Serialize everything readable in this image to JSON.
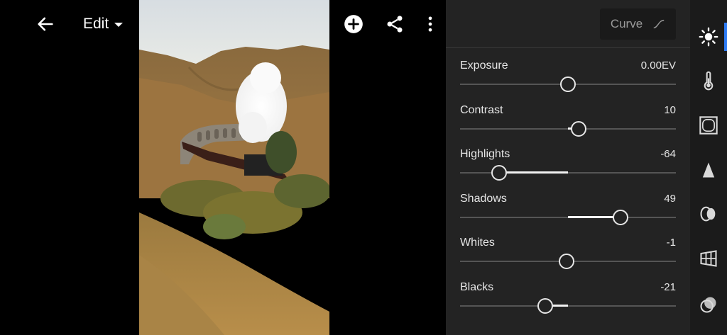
{
  "toolbar": {
    "back_icon": "arrow-left-icon",
    "edit_label": "Edit",
    "icons": [
      "undo-icon",
      "help-icon",
      "add-icon",
      "share-icon",
      "more-vertical-icon"
    ]
  },
  "panel": {
    "curve_label": "Curve",
    "sliders": [
      {
        "label": "Exposure",
        "value": "0.00EV",
        "position": 0.5,
        "fill_from": 0.5,
        "fill_to": 0.5
      },
      {
        "label": "Contrast",
        "value": "10",
        "position": 0.55,
        "fill_from": 0.5,
        "fill_to": 0.55
      },
      {
        "label": "Highlights",
        "value": "-64",
        "position": 0.18,
        "fill_from": 0.18,
        "fill_to": 0.5
      },
      {
        "label": "Shadows",
        "value": "49",
        "position": 0.745,
        "fill_from": 0.5,
        "fill_to": 0.745
      },
      {
        "label": "Whites",
        "value": "-1",
        "position": 0.495,
        "fill_from": 0.495,
        "fill_to": 0.5
      },
      {
        "label": "Blacks",
        "value": "-21",
        "position": 0.395,
        "fill_from": 0.395,
        "fill_to": 0.5
      }
    ]
  },
  "rail": {
    "items": [
      "light-icon",
      "color-temperature-icon",
      "effects-icon",
      "detail-icon",
      "optics-icon",
      "geometry-icon",
      "mixer-icon"
    ],
    "active_index": 0,
    "accent": "#2d7bf4"
  }
}
